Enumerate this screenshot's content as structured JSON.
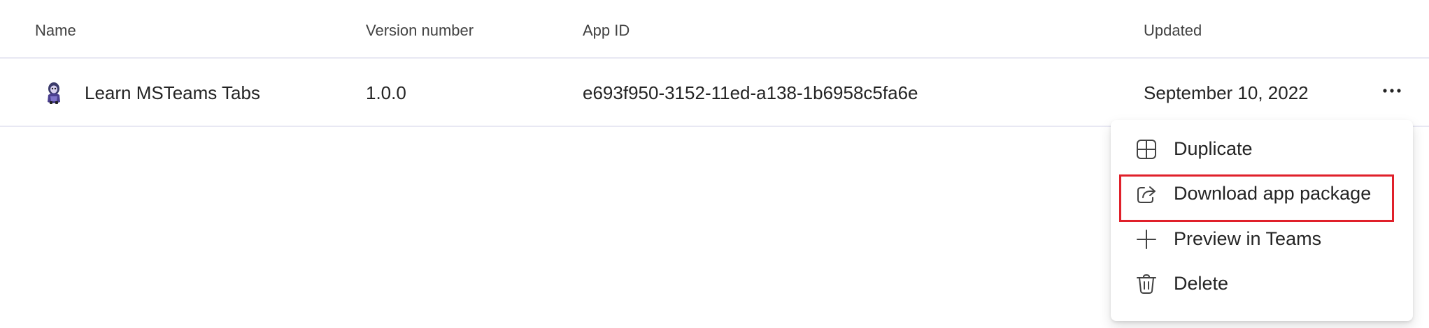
{
  "table": {
    "columns": [
      "Name",
      "Version number",
      "App ID",
      "Updated"
    ],
    "rows": [
      {
        "name": "Learn MSTeams Tabs",
        "version": "1.0.0",
        "app_id": "e693f950-3152-11ed-a138-1b6958c5fa6e",
        "updated": "September 10, 2022",
        "icon": "app-logo-icon",
        "more_label": "···"
      }
    ]
  },
  "context_menu": {
    "items": [
      {
        "label": "Duplicate",
        "icon": "duplicate-icon"
      },
      {
        "label": "Download app package",
        "icon": "share-export-icon",
        "highlighted": true
      },
      {
        "label": "Preview in Teams",
        "icon": "plus-icon"
      },
      {
        "label": "Delete",
        "icon": "trash-icon"
      }
    ]
  },
  "colors": {
    "highlight_border": "#e0202a",
    "row_divider": "#e8e8f3",
    "text": "#242424"
  }
}
